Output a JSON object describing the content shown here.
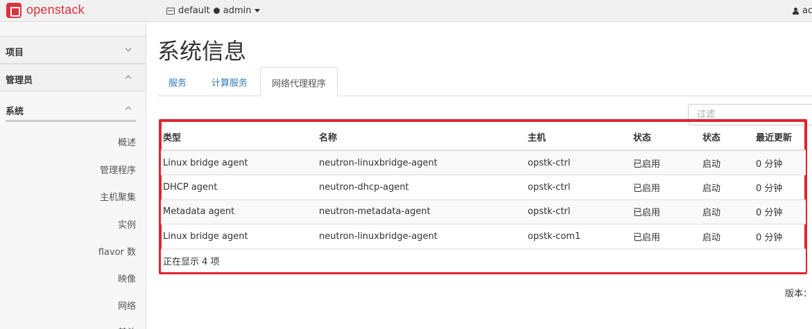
{
  "brand": {
    "name": "openstack"
  },
  "topbar": {
    "project": "default",
    "user_context": "admin",
    "user": "ac"
  },
  "sidebar": {
    "sections": [
      {
        "label": "项目",
        "expanded": false
      },
      {
        "label": "管理员",
        "expanded": true
      }
    ],
    "subsection": {
      "label": "系统",
      "expanded": true
    },
    "items": [
      "概述",
      "管理程序",
      "主机聚集",
      "实例",
      "flavor 数",
      "映像",
      "网络",
      "其他"
    ]
  },
  "page": {
    "title": "系统信息"
  },
  "tabs": [
    {
      "label": "服务",
      "active": false
    },
    {
      "label": "计算服务",
      "active": false
    },
    {
      "label": "网络代理程序",
      "active": true
    }
  ],
  "filter": {
    "placeholder": "过滤"
  },
  "table": {
    "columns": [
      "类型",
      "名称",
      "主机",
      "状态",
      "状态",
      "最近更新"
    ],
    "rows": [
      [
        "Linux bridge agent",
        "neutron-linuxbridge-agent",
        "opstk-ctrl",
        "已启用",
        "启动",
        "0 分钟"
      ],
      [
        "DHCP agent",
        "neutron-dhcp-agent",
        "opstk-ctrl",
        "已启用",
        "启动",
        "0 分钟"
      ],
      [
        "Metadata agent",
        "neutron-metadata-agent",
        "opstk-ctrl",
        "已启用",
        "启动",
        "0 分钟"
      ],
      [
        "Linux bridge agent",
        "neutron-linuxbridge-agent",
        "opstk-com1",
        "已启用",
        "启动",
        "0 分钟"
      ]
    ],
    "footer": "正在显示 4 项"
  },
  "version_label": "版本："
}
